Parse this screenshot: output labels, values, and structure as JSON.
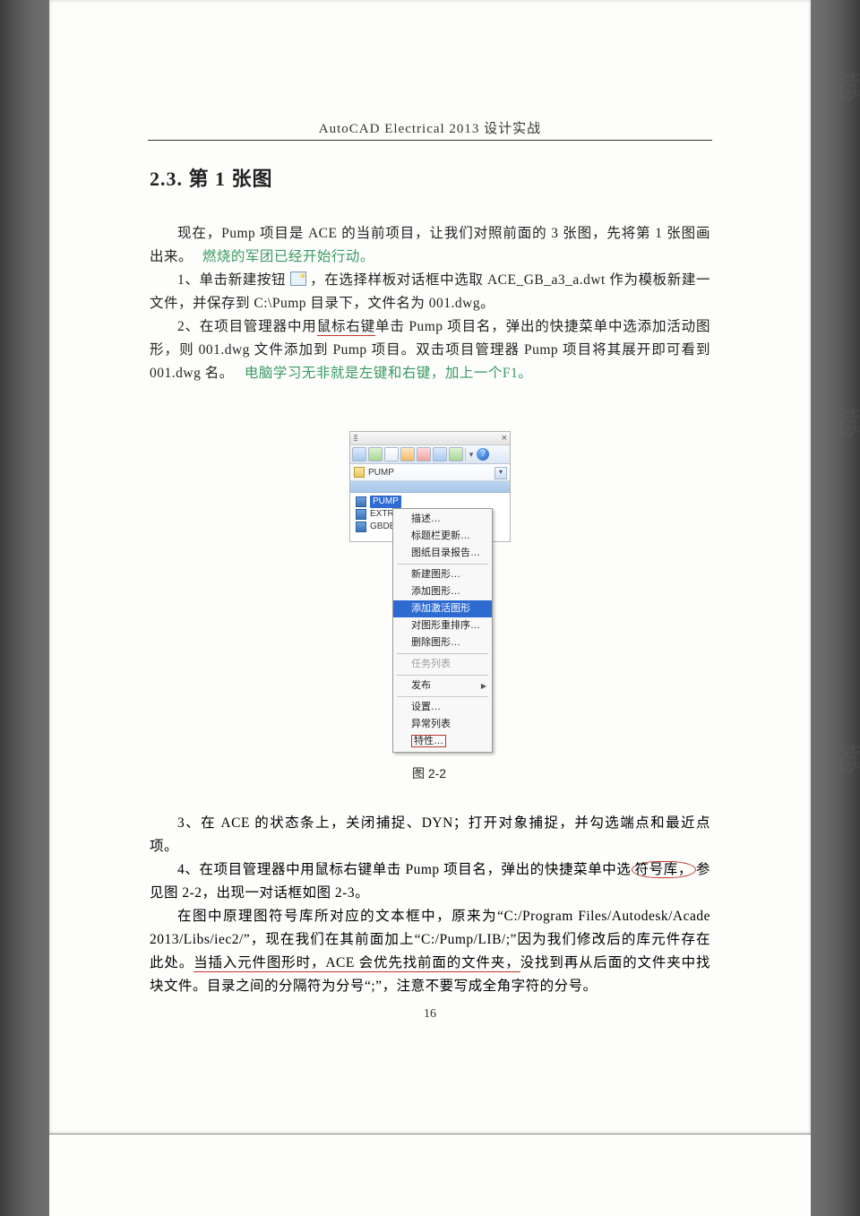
{
  "running_head": "AutoCAD Electrical 2013  设计实战",
  "section_title": "2.3. 第 1 张图",
  "para1a": "现在，Pump 项目是 ACE 的当前项目，让我们对照前面的 3 张图，先将第 1 张图画出来。",
  "annot1": "燃烧的军团已经开始行动。",
  "para2_lead": "1、单击新建按钮",
  "para2_rest": "，在选择样板对话框中选取 ACE_GB_a3_a.dwt 作为模板新建一文件，并保存到 C:\\Pump 目录下，文件名为 001.dwg。",
  "para3_a": "2、在项目管理器中用",
  "para3_b": "鼠标右键",
  "para3_c": "单击 Pump 项目名，弹出的快捷菜单中选添加活动图形，则 001.dwg 文件添加到 Pump 项目。双击项目管理器 Pump 项目将其展开即可看到 001.dwg 名。",
  "annot2": "电脑学习无非就是左键和右键，加上一个F1。",
  "figure_panel": {
    "project_label": "PUMP",
    "tree": [
      "PUMP",
      "EXTRA",
      "GBDEMO"
    ],
    "close_glyph": "×",
    "dd_glyph": "▾",
    "help_glyph": "?"
  },
  "context_menu": {
    "items": [
      {
        "label": "描述…"
      },
      {
        "label": "标题栏更新…"
      },
      {
        "label": "图纸目录报告…"
      },
      {
        "sep": true
      },
      {
        "label": "新建图形…"
      },
      {
        "label": "添加图形…"
      },
      {
        "label": "添加激活图形",
        "hi": true
      },
      {
        "label": "对图形重排序…"
      },
      {
        "label": "删除图形…"
      },
      {
        "sep": true
      },
      {
        "label": "任务列表",
        "dis": true
      },
      {
        "sep": true
      },
      {
        "label": "发布",
        "arrow": true
      },
      {
        "sep": true
      },
      {
        "label": "设置…"
      },
      {
        "label": "异常列表"
      },
      {
        "label": "特性…",
        "boxed": true
      }
    ]
  },
  "figure_caption": "图  2-2",
  "para4": "3、在 ACE 的状态条上，关闭捕捉、DYN；打开对象捕捉，并勾选端点和最近点项。",
  "para5_a": "4、在项目管理器中用鼠标右键单击 Pump 项目名，弹出的快捷菜单中选",
  "para5_b": "符号库，",
  "para5_c": "参见图 2-2，出现一对话框如图 2-3。",
  "para6_a": "在图中原理图符号库所对应的文本框中，原来为“C:/Program Files/Autodesk/Acade 2013/Libs/iec2/”，现在我们在其前面加上“C:/Pump/LIB/;”因为我们修改后的库元件存在此处。",
  "para6_b": "当插入元件图形时，ACE 会优先找前面的文件夹，",
  "para6_c": "没找到再从后面的文件夹中找块文件。目录之间的分隔符为分号“;”，注意不要写成全角字符的分号。",
  "page_number": "16",
  "watermark": "读"
}
